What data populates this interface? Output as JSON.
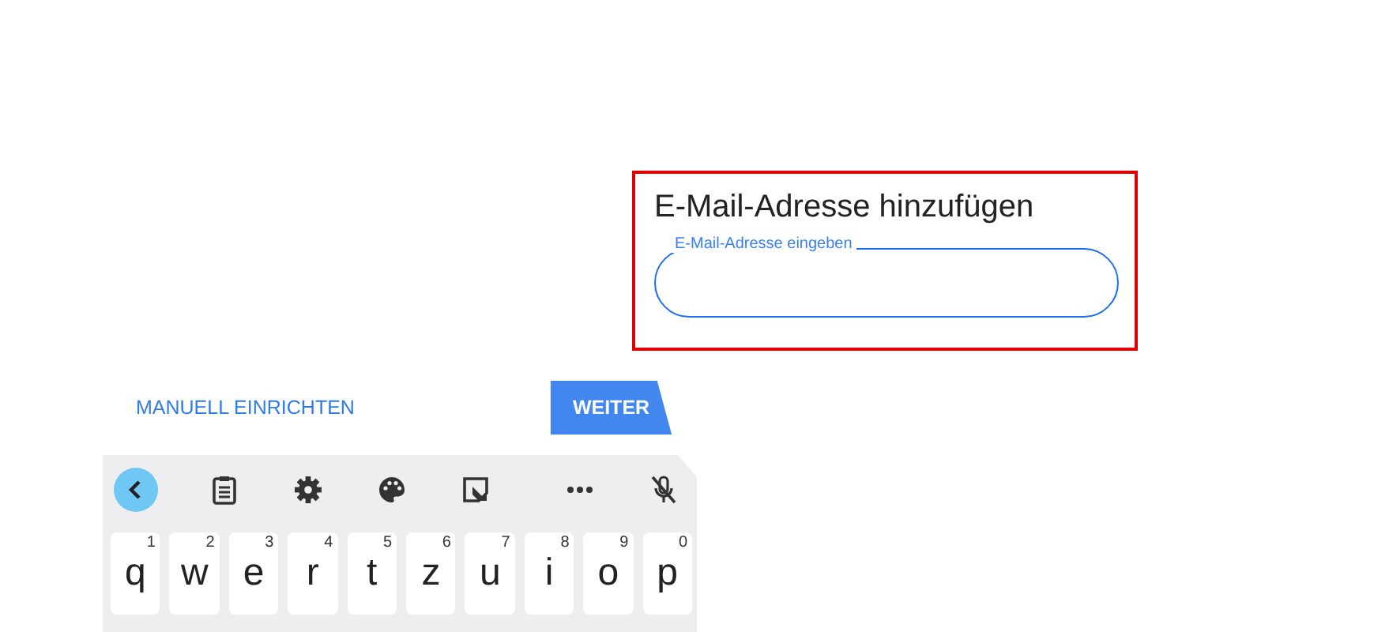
{
  "dialog": {
    "title": "E-Mail-Adresse hinzufügen",
    "highlighted": true,
    "field": {
      "label": "E-Mail-Adresse eingeben",
      "focused": true
    }
  },
  "buttons": [
    {
      "label": "MANUELL EINRICHTEN",
      "kind": "text"
    },
    {
      "label": "WEITER",
      "kind": "filled"
    }
  ],
  "keyboard": {
    "keys": [
      {
        "char": "q",
        "hint": "1"
      },
      {
        "char": "w",
        "hint": "2"
      },
      {
        "char": "e",
        "hint": "3"
      },
      {
        "char": "r",
        "hint": "4"
      },
      {
        "char": "t",
        "hint": "5"
      },
      {
        "char": "z",
        "hint": "6"
      },
      {
        "char": "u",
        "hint": "7"
      },
      {
        "char": "i",
        "hint": "8"
      },
      {
        "char": "o",
        "hint": "9"
      },
      {
        "char": "p",
        "hint": "0"
      }
    ]
  }
}
